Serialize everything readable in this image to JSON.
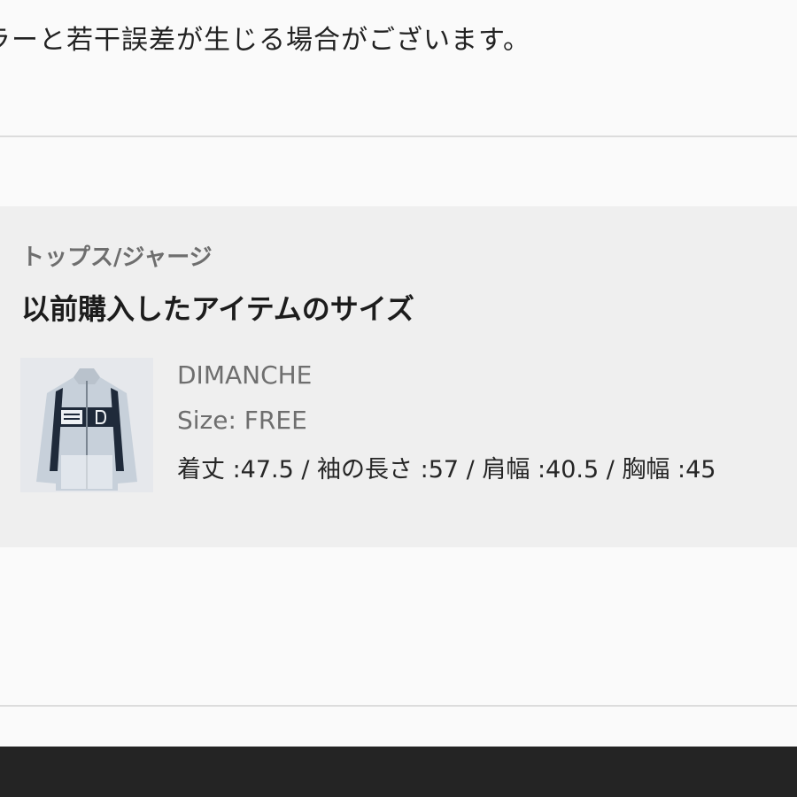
{
  "notice": {
    "text": "ラーと若干誤差が生じる場合がございます。"
  },
  "previous_purchase": {
    "category": "トップス/ジャージ",
    "title": "以前購入したアイテムのサイズ",
    "item": {
      "image_icon": "track-jacket-thumbnail",
      "brand": "DIMANCHE",
      "size_line": "Size: FREE",
      "measurements": "着丈 :47.5 / 袖の長さ :57 / 肩幅 :40.5 / 胸幅 :45"
    }
  },
  "colors": {
    "background": "#fafafa",
    "card": "#efefef",
    "bottom_bar": "#242424"
  }
}
